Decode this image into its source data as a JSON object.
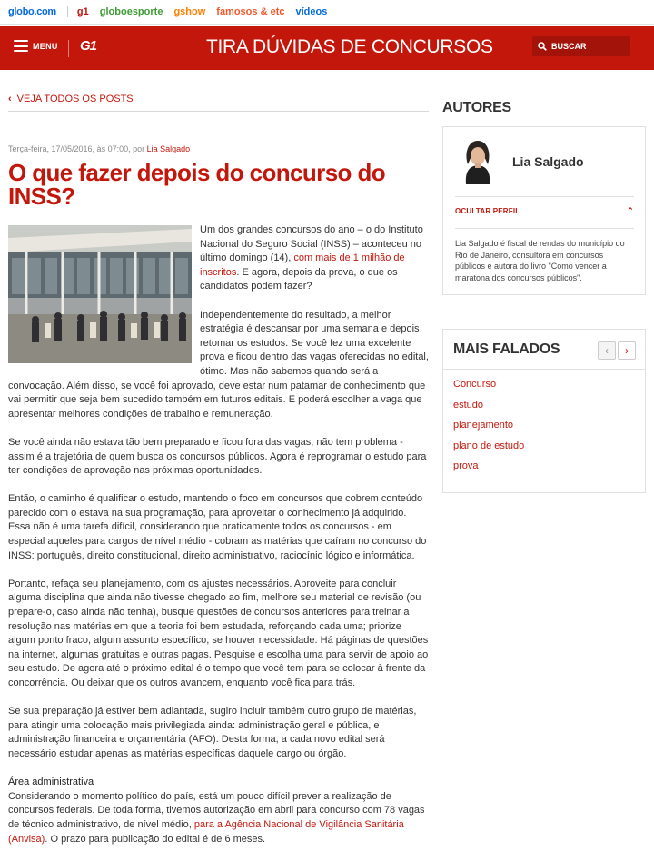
{
  "globo_bar": {
    "items": [
      {
        "label": "globo.com",
        "color": "#0669de"
      },
      {
        "label": "g1",
        "color": "#c4170c"
      },
      {
        "label": "globoesporte",
        "color": "#3f9c35"
      },
      {
        "label": "gshow",
        "color": "#ff7f00"
      },
      {
        "label": "famosos & etc",
        "color": "#f1592a"
      },
      {
        "label": "vídeos",
        "color": "#0669de"
      }
    ]
  },
  "header": {
    "menu_label": "MENU",
    "logo": "G1",
    "site_title": "TIRA DÚVIDAS DE CONCURSOS",
    "search_label": "BUSCAR",
    "brand_color": "#c4170c"
  },
  "post": {
    "back_link": "VEJA TODOS OS POSTS",
    "meta_prefix": "Terça-feira, 17/05/2016, às 07:00, por ",
    "meta_author": "Lia Salgado",
    "title": "O que fazer depois do concurso do INSS?",
    "p1_a": "Um dos grandes concursos do ano – o do Instituto Nacional do Seguro Social (INSS) – aconteceu no último domingo (14), ",
    "p1_link": "com mais de 1 milhão de inscritos",
    "p1_b": ". E agora, depois da prova, o que os candidatos podem fazer?",
    "p2": "Independentemente do resultado, a melhor estratégia é descansar por uma semana e depois retomar os estudos. Se você fez uma excelente prova e ficou dentro das vagas oferecidas no edital, ótimo. Mas não sabemos quando será a convocação. Além disso, se você foi aprovado, deve estar num patamar de conhecimento que vai permitir que seja bem sucedido também em futuros editais. E poderá escolher a vaga que apresentar melhores condições de trabalho e remuneração.",
    "p3": "Se você ainda não estava tão bem preparado e ficou fora das vagas, não tem problema - assim é a trajetória de quem busca os concursos públicos. Agora é reprogramar o estudo para ter condições de aprovação nas próximas oportunidades.",
    "p4": "Então, o caminho é qualificar o estudo, mantendo o foco em concursos que cobrem conteúdo parecido com o estava na sua programação, para aproveitar o conhecimento já adquirido. Essa não é uma tarefa difícil, considerando que praticamente todos os concursos - em especial aqueles para cargos de nível médio - cobram as matérias que caíram no concurso do INSS: português, direito constitucional, direito administrativo, raciocínio lógico e informática.",
    "p5": "Portanto, refaça seu planejamento, com os ajustes necessários. Aproveite para concluir alguma disciplina que ainda não tivesse chegado ao fim, melhore seu material de revisão (ou prepare-o, caso ainda não tenha), busque questões de concursos anteriores para treinar a resolução nas matérias em que a teoria foi bem estudada, reforçando cada uma; priorize algum ponto fraco, algum assunto específico, se houver necessidade. Há páginas de questões na internet, algumas gratuitas e outras pagas. Pesquise e escolha uma para servir de apoio ao seu estudo. De agora até o próximo edital é o tempo que você tem para se colocar à frente da concorrência. Ou deixar que os outros avancem, enquanto você fica para trás.",
    "p6": "Se sua preparação já estiver bem adiantada, sugiro incluir também outro grupo de matérias, para atingir uma colocação mais privilegiada ainda: administração geral e pública, e administração financeira e orçamentária (AFO). Desta forma, a cada novo edital será necessário estudar apenas as matérias específicas daquele cargo ou órgão.",
    "subhead": "Área administrativa",
    "p7_a": "Considerando o momento político do país, está um pouco difícil prever a realização de concursos federais. De toda forma, tivemos autorização em abril para concurso com 78 vagas de técnico administrativo, de nível médio, ",
    "p7_link": "para a Agência  Nacional de Vigilância Sanitária (Anvisa)",
    "p7_b": ". O prazo para publicação do edital é de 6 meses."
  },
  "sidebar": {
    "authors_heading": "AUTORES",
    "author_name": "Lia Salgado",
    "hide_profile": "OCULTAR PERFIL",
    "bio": "Lia Salgado é fiscal de rendas do município do Rio de Janeiro, consultora em concursos públicos e autora do livro \"Como vencer a maratona dos concursos públicos\".",
    "most_talked_heading": "MAIS FALADOS",
    "most_talked": [
      "Concurso",
      "estudo",
      "planejamento",
      "plano de estudo",
      "prova"
    ]
  }
}
